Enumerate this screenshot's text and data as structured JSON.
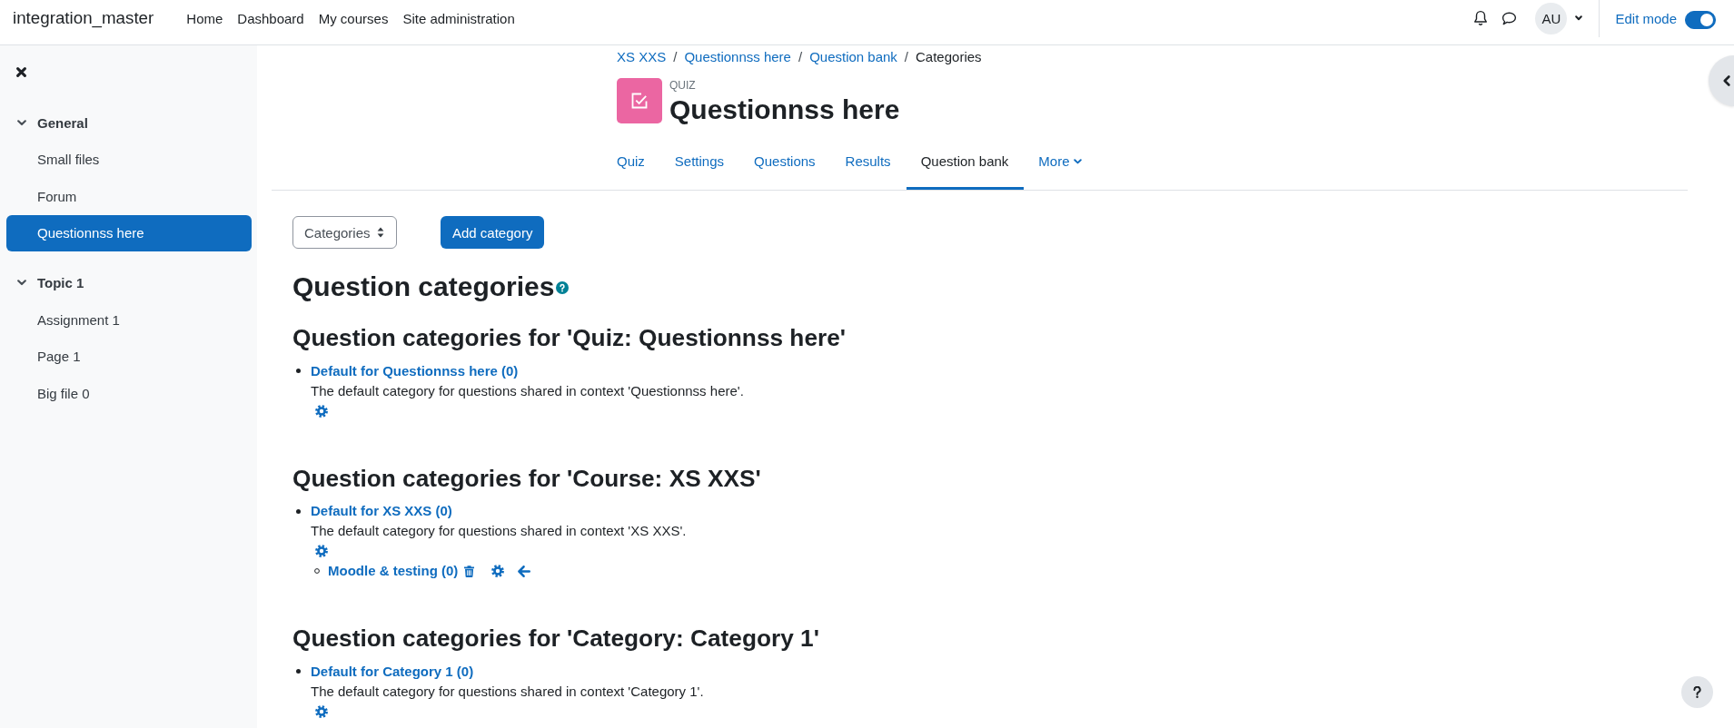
{
  "navbar": {
    "site_name": "integration_master",
    "links": [
      {
        "label": "Home"
      },
      {
        "label": "Dashboard"
      },
      {
        "label": "My courses"
      },
      {
        "label": "Site administration"
      }
    ],
    "avatar_initials": "AU",
    "edit_mode": {
      "label": "Edit mode",
      "on": true
    }
  },
  "course_index": {
    "sections": [
      {
        "title": "General",
        "expanded": true,
        "items": [
          {
            "label": "Small files",
            "selected": false
          },
          {
            "label": "Forum",
            "selected": false
          },
          {
            "label": "Questionnss here",
            "selected": true
          }
        ]
      },
      {
        "title": "Topic 1",
        "expanded": true,
        "items": [
          {
            "label": "Assignment 1",
            "selected": false
          },
          {
            "label": "Page 1",
            "selected": false
          },
          {
            "label": "Big file 0",
            "selected": false
          }
        ]
      }
    ]
  },
  "breadcrumb": {
    "items": [
      {
        "label": "XS XXS",
        "current": false
      },
      {
        "separator": "/",
        "label": "Questionnss here",
        "current": false
      },
      {
        "separator": "/",
        "label": "Question bank",
        "current": false
      },
      {
        "separator": "/",
        "label": "Categories",
        "current": true
      }
    ]
  },
  "page_header": {
    "activity_type": "QUIZ",
    "title": "Questionnss here"
  },
  "tabs": [
    {
      "label": "Quiz",
      "selected": false,
      "kind": "link"
    },
    {
      "label": "Settings",
      "selected": false,
      "kind": "link"
    },
    {
      "label": "Questions",
      "selected": false,
      "kind": "link"
    },
    {
      "label": "Results",
      "selected": false,
      "kind": "link"
    },
    {
      "label": "Question bank",
      "selected": true,
      "kind": "link"
    },
    {
      "label": "More",
      "selected": false,
      "kind": "menu"
    }
  ],
  "toolbar": {
    "select_value": "Categories",
    "button_label": "Add category"
  },
  "heading": "Question categories",
  "contexts": [
    {
      "heading": "Question categories for 'Quiz: Questionnss here'",
      "categories": [
        {
          "name": "Default for Questionnss here (0)",
          "description": "The default category for questions shared in context 'Questionnss here'.",
          "actions": [
            {
              "kind": "edit"
            }
          ]
        }
      ]
    },
    {
      "heading": "Question categories for 'Course: XS XXS'",
      "categories": [
        {
          "name": "Default for XS XXS (0)",
          "description": "The default category for questions shared in context 'XS XXS'.",
          "actions": [
            {
              "kind": "edit"
            }
          ],
          "children": [
            {
              "name": "Moodle & testing (0)",
              "actions": [
                {
                  "kind": "delete"
                },
                {
                  "kind": "edit"
                },
                {
                  "kind": "move_left"
                }
              ]
            }
          ]
        }
      ]
    },
    {
      "heading": "Question categories for 'Category: Category 1'",
      "categories": [
        {
          "name": "Default for Category 1 (0)",
          "description": "The default category for questions shared in context 'Category 1'.",
          "actions": [
            {
              "kind": "edit"
            }
          ]
        }
      ]
    }
  ]
}
